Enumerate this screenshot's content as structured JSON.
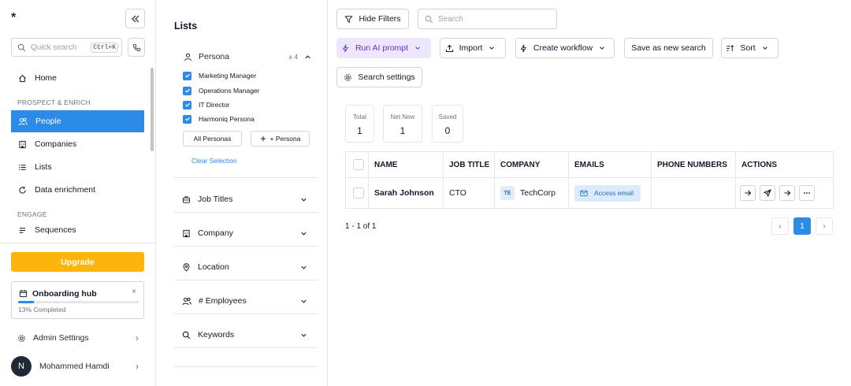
{
  "sidebar": {
    "logo": "*",
    "quick_search": {
      "placeholder": "Quick search",
      "shortcut": "Ctrl+K"
    },
    "items": {
      "home": "Home",
      "section_prospect": "PROSPECT & ENRICH",
      "people": "People",
      "companies": "Companies",
      "lists": "Lists",
      "data_enrichment": "Data enrichment",
      "section_engage": "ENGAGE",
      "sequences": "Sequences"
    },
    "upgrade_label": "Upgrade",
    "onboarding": {
      "title": "Onboarding hub",
      "progress_text": "13% Completed",
      "progress_percent": 13,
      "close_glyph": "×"
    },
    "admin_settings": "Admin Settings",
    "user": {
      "initial": "N",
      "name": "Mohammed Hamdi"
    }
  },
  "filters": {
    "title": "Lists",
    "persona": {
      "label": "Persona",
      "count": "x 4",
      "options": [
        "Marketing Manager",
        "Operations Manager",
        "IT Director",
        "Harmoniq Persona"
      ],
      "all_button": "All Personas",
      "add_button": "+ Persona",
      "clear": "Clear Selection"
    },
    "groups": {
      "job_titles": "Job Titles",
      "company": "Company",
      "location": "Location",
      "employees": "# Employees",
      "keywords": "Keywords"
    }
  },
  "toolbar": {
    "hide_filters": "Hide Filters",
    "search_placeholder": "Search",
    "run_ai": "Run AI prompt",
    "import": "Import",
    "create_workflow": "Create workflow",
    "save_search": "Save as new search",
    "sort": "Sort",
    "search_settings": "Search settings"
  },
  "stats": {
    "total": {
      "label": "Total",
      "value": "1"
    },
    "net_new": {
      "label": "Net New",
      "value": "1"
    },
    "saved": {
      "label": "Saved",
      "value": "0"
    }
  },
  "table": {
    "columns": [
      "NAME",
      "JOB TITLE",
      "COMPANY",
      "EMAILS",
      "PHONE NUMBERS",
      "ACTIONS"
    ],
    "rows": [
      {
        "name": "Sarah Johnson",
        "job_title": "CTO",
        "company_initials": "TE",
        "company": "TechCorp",
        "email_action": "Access email",
        "phone": ""
      }
    ]
  },
  "pagination": {
    "summary": "1 - 1 of 1",
    "current_page": "1",
    "prev": "‹",
    "next": "›"
  },
  "colors": {
    "accent": "#2b8be6",
    "upgrade": "#fbb50d",
    "ai_bg": "#ede7fb",
    "ai_text": "#6d28d9"
  },
  "icons": [
    "collapse-icon",
    "search-icon",
    "phone-icon",
    "home-icon",
    "people-icon",
    "building-icon",
    "list-icon",
    "enrich-icon",
    "sparkle-icon",
    "upload-icon",
    "bolt-icon",
    "sort-icon",
    "gear-icon",
    "filter-icon",
    "mail-icon",
    "send-icon",
    "arrow-right-icon",
    "more-icon",
    "briefcase-icon",
    "pin-icon",
    "calendar-icon",
    "chevron-down-icon",
    "chevron-up-icon"
  ]
}
